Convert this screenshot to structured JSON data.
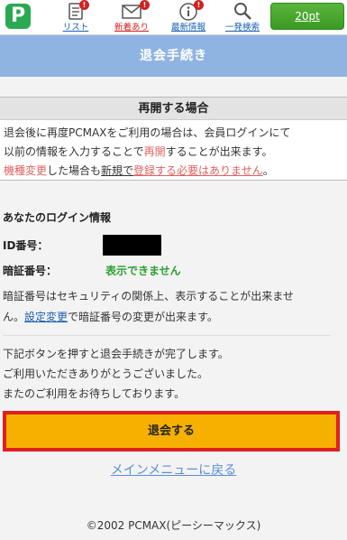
{
  "nav": {
    "logo": "P",
    "items": [
      {
        "label": "リスト",
        "color": "blue",
        "icon": "list-icon",
        "badge": "!"
      },
      {
        "label": "新着あり",
        "color": "red",
        "icon": "mail-icon",
        "badge": "!"
      },
      {
        "label": "最新情報",
        "color": "blue",
        "icon": "info-icon",
        "badge": "!"
      },
      {
        "label": "一発検索",
        "color": "blue",
        "icon": "search-icon",
        "badge": ""
      }
    ],
    "points": "20pt"
  },
  "title": "退会手続き",
  "resume": {
    "heading": "再開する場合",
    "line1": "退会後に再度PCMAXをご利用の場合は、会員ログインにて",
    "line2_a": "以前の情報を入力することで",
    "line2_hl": "再開",
    "line2_b": "することが出来ます。",
    "line3_hl": "機種変更",
    "line3_a": "した場合も",
    "line3_ul1": "新規で",
    "line3_ul2": "登録する必要はありません",
    "line3_b": "。"
  },
  "login": {
    "heading": "あなたのログイン情報",
    "id_label": "ID番号：",
    "pw_label": "暗証番号：",
    "pw_value": "表示できません",
    "note_a": "暗証番号はセキュリティの関係上、表示することが出来ませ",
    "note_b": "ん。",
    "note_link": "設定変更",
    "note_c": "で暗証番号の変更が出来ます。"
  },
  "finish": {
    "line1": "下記ボタンを押すと退会手続きが完了します。",
    "line2": "ご利用いただきありがとうございました。",
    "line3": "またのご利用をお待ちしております。"
  },
  "withdraw_button": "退会する",
  "menu_link": "メインメニューに戻る",
  "footer": "©2002 PCMAX(ピーシーマックス)",
  "colors": {
    "accent": "#90b4e2",
    "button": "#f6b100",
    "button_border": "#e02020",
    "green": "#2aa853"
  }
}
